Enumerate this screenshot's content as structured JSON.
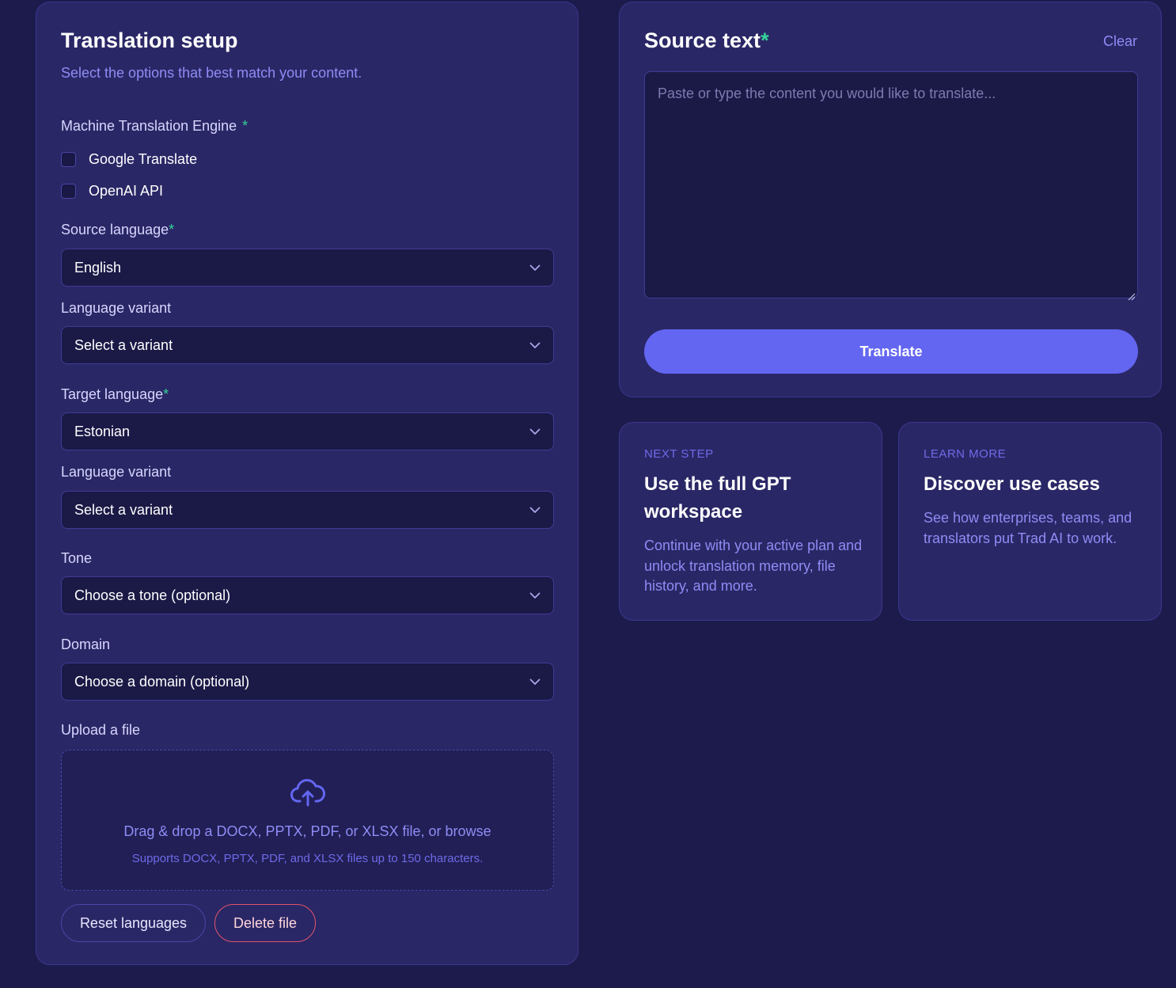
{
  "setup": {
    "title": "Translation setup",
    "subtitle": "Select the options that best match your content.",
    "required_marker": "*",
    "engine_label": "Machine Translation Engine",
    "engines": [
      {
        "label": "Google Translate",
        "checked": false
      },
      {
        "label": "OpenAI API",
        "checked": false
      }
    ],
    "source_language_label": "Source language",
    "source_language_value": "English",
    "source_variant_label": "Language variant",
    "source_variant_value": "Select a variant",
    "target_language_label": "Target language",
    "target_language_value": "Estonian",
    "target_variant_label": "Language variant",
    "target_variant_value": "Select a variant",
    "tone_label": "Tone",
    "tone_value": "Choose a tone (optional)",
    "domain_label": "Domain",
    "domain_value": "Choose a domain (optional)",
    "upload_label": "Upload a file",
    "upload_main": "Drag & drop a DOCX, PPTX, PDF, or XLSX file, or browse",
    "upload_sub": "Supports DOCX, PPTX, PDF, and XLSX files up to 150 characters.",
    "reset_button": "Reset languages",
    "delete_button": "Delete file"
  },
  "source": {
    "title": "Source text",
    "required_marker": "*",
    "clear_label": "Clear",
    "placeholder": "Paste or type the content you would like to translate...",
    "translate_button": "Translate"
  },
  "cards": {
    "next": {
      "eyebrow": "NEXT STEP",
      "title": "Use the full GPT workspace",
      "body": "Continue with your active plan and unlock translation memory, file history, and more."
    },
    "learn": {
      "eyebrow": "LEARN MORE",
      "title": "Discover use cases",
      "body": "See how enterprises, teams, and translators put Trad AI to work."
    }
  },
  "icons": {
    "chevron": "chevron-down-icon",
    "upload": "cloud-upload-icon"
  },
  "colors": {
    "background": "#1d1b4b",
    "panel": "#2a2766",
    "accent": "#6366f1",
    "required": "#34d399",
    "muted_text": "#8f8cf5",
    "danger": "#e2546a"
  }
}
